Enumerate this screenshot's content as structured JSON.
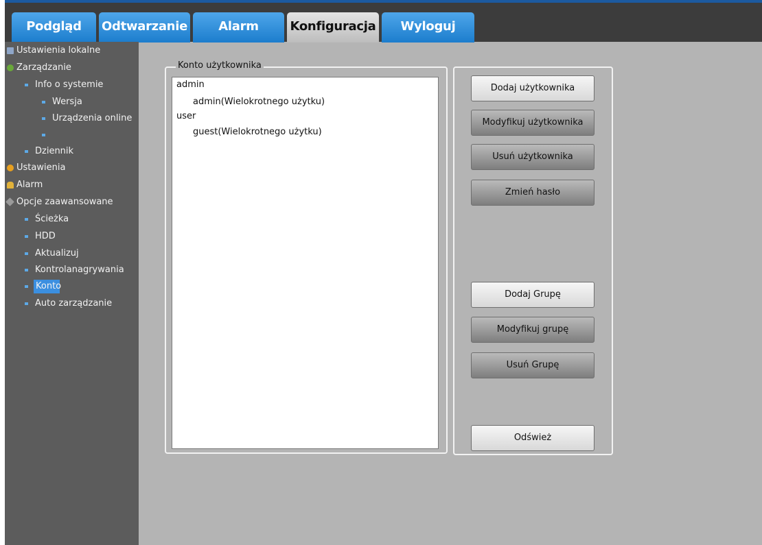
{
  "nav": {
    "tabs": [
      {
        "label": "Podgląd"
      },
      {
        "label": "Odtwarzanie"
      },
      {
        "label": "Alarm"
      },
      {
        "label": "Konfiguracja"
      },
      {
        "label": "Wyloguj"
      }
    ],
    "active_tab": "Konfiguracja"
  },
  "sidebar": {
    "items": [
      {
        "label": "Ustawienia lokalne",
        "icon": "monitor-icon"
      },
      {
        "label": "Zarządzanie",
        "icon": "info-icon"
      },
      {
        "label": "Info o systemie"
      },
      {
        "label": "Wersja"
      },
      {
        "label": "Urządzenia online"
      },
      {
        "label": ""
      },
      {
        "label": "Dziennik"
      },
      {
        "label": "Ustawienia",
        "icon": "gear-icon"
      },
      {
        "label": "Alarm",
        "icon": "bell-icon"
      },
      {
        "label": "Opcje zaawansowane",
        "icon": "tools-icon"
      },
      {
        "label": "Ścieżka"
      },
      {
        "label": "HDD"
      },
      {
        "label": "Aktualizuj"
      },
      {
        "label": "Kontrolanagrywania"
      },
      {
        "label": "Konto"
      },
      {
        "label": "Auto zarządzanie"
      }
    ],
    "selected": "Konto"
  },
  "account": {
    "group_title": "Konto użytkownika",
    "tree": [
      {
        "label": "admin",
        "level": 0
      },
      {
        "label": "admin(Wielokrotnego użytku)",
        "level": 1
      },
      {
        "label": "user",
        "level": 0
      },
      {
        "label": "guest(Wielokrotnego użytku)",
        "level": 1
      }
    ]
  },
  "buttons": {
    "add_user": "Dodaj użytkownika",
    "modify_user": "Modyfikuj użytkownika",
    "delete_user": "Usuń użytkownika",
    "change_password": "Zmień hasło",
    "add_group": "Dodaj Grupę",
    "modify_group": "Modyfikuj grupę",
    "delete_group": "Usuń Grupę",
    "refresh": "Odśwież"
  },
  "colors": {
    "tab_blue": "#2f8fdc",
    "tab_active": "#d0d0d0",
    "sidebar_bg": "#5c5c5c",
    "content_bg": "#b4b4b4",
    "selection": "#3b8fe0"
  }
}
